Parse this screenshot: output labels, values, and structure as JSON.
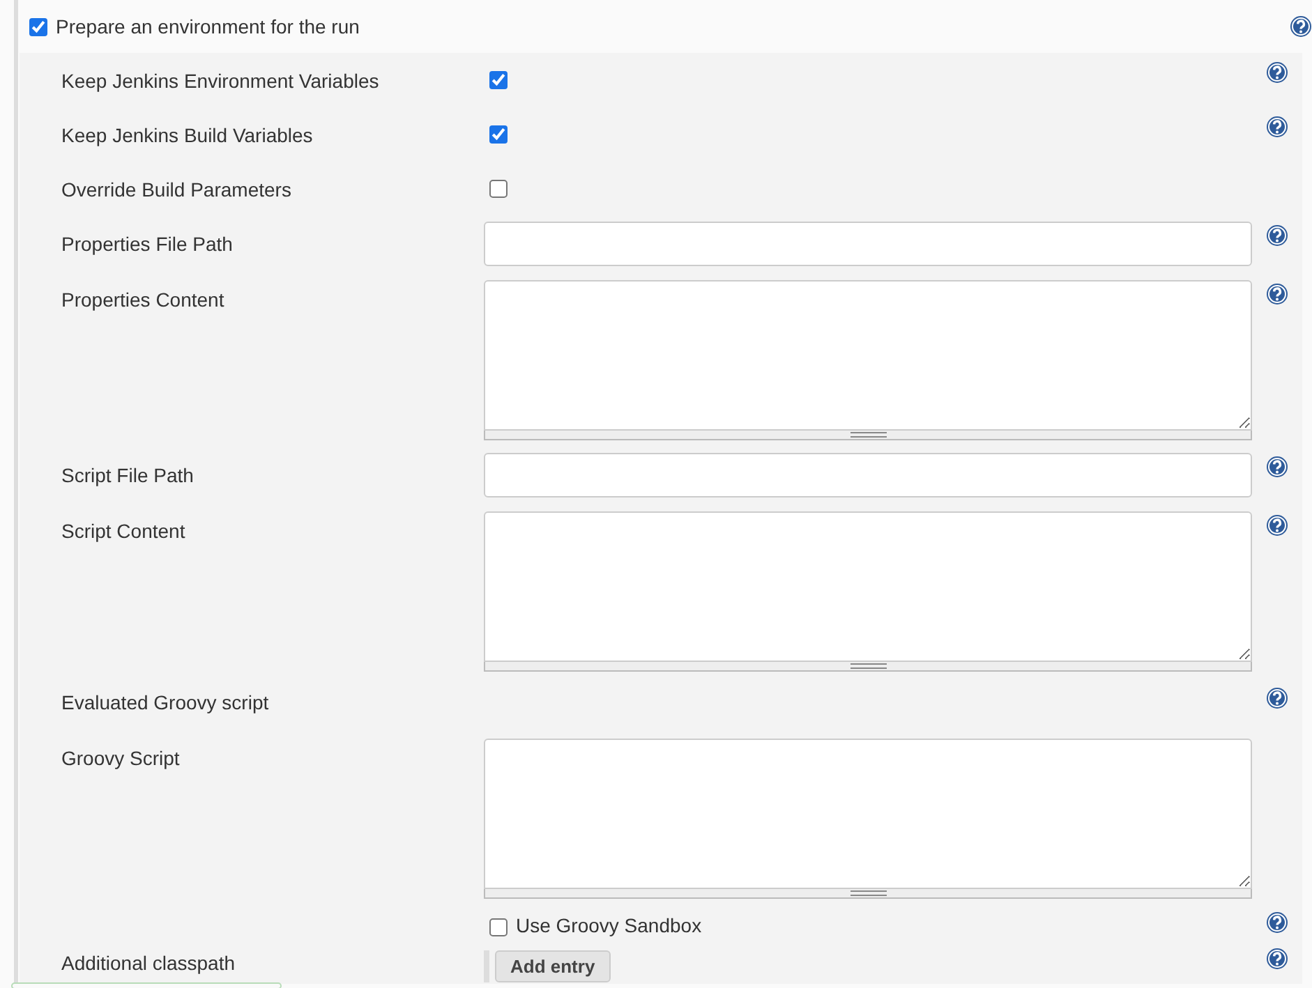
{
  "section": {
    "label": "Prepare an environment for the run",
    "checked": true,
    "help": true
  },
  "rows": [
    {
      "kind": "checkbox",
      "label": "Keep Jenkins Environment Variables",
      "checked": true,
      "help": true
    },
    {
      "kind": "checkbox",
      "label": "Keep Jenkins Build Variables",
      "checked": true,
      "help": true
    },
    {
      "kind": "checkbox",
      "label": "Override Build Parameters",
      "checked": false,
      "help": false
    },
    {
      "kind": "text",
      "label": "Properties File Path",
      "help": true
    },
    {
      "kind": "textarea",
      "label": "Properties Content",
      "help": true
    },
    {
      "kind": "text",
      "label": "Script File Path",
      "help": true
    },
    {
      "kind": "textarea",
      "label": "Script Content",
      "help": true
    },
    {
      "kind": "heading",
      "label": "Evaluated Groovy script",
      "help": true
    },
    {
      "kind": "textarea",
      "label": "Groovy Script",
      "help": false
    },
    {
      "kind": "option",
      "option": "Use Groovy Sandbox",
      "checked": false,
      "help": true
    },
    {
      "kind": "button",
      "label": "Additional classpath",
      "button": "Add entry",
      "help": true
    }
  ]
}
